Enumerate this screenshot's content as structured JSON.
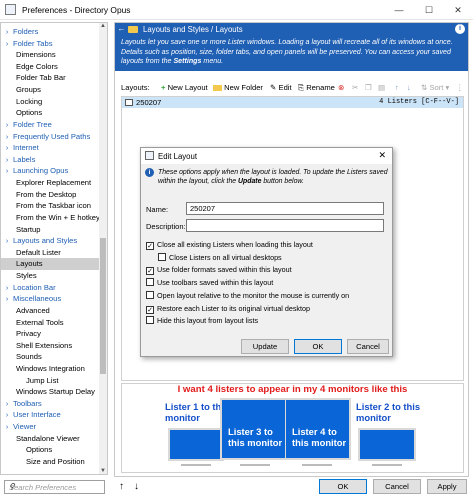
{
  "window": {
    "title": "Preferences - Directory Opus",
    "min": "—",
    "max": "☐",
    "close": "✕"
  },
  "sidebar": [
    {
      "label": "Folders",
      "type": "cat"
    },
    {
      "label": "Folder Tabs",
      "type": "cat"
    },
    {
      "label": "Dimensions",
      "type": "sub"
    },
    {
      "label": "Edge Colors",
      "type": "sub"
    },
    {
      "label": "Folder Tab Bar",
      "type": "sub"
    },
    {
      "label": "Groups",
      "type": "sub"
    },
    {
      "label": "Locking",
      "type": "sub"
    },
    {
      "label": "Options",
      "type": "sub"
    },
    {
      "label": "Folder Tree",
      "type": "cat"
    },
    {
      "label": "Frequently Used Paths",
      "type": "cat"
    },
    {
      "label": "Internet",
      "type": "cat"
    },
    {
      "label": "Labels",
      "type": "cat"
    },
    {
      "label": "Launching Opus",
      "type": "cat"
    },
    {
      "label": "Explorer Replacement",
      "type": "sub"
    },
    {
      "label": "From the Desktop",
      "type": "sub"
    },
    {
      "label": "From the Taskbar icon",
      "type": "sub"
    },
    {
      "label": "From the Win + E hotkey",
      "type": "sub"
    },
    {
      "label": "Startup",
      "type": "sub"
    },
    {
      "label": "Layouts and Styles",
      "type": "cat"
    },
    {
      "label": "Default Lister",
      "type": "sub"
    },
    {
      "label": "Layouts",
      "type": "sub",
      "selected": true
    },
    {
      "label": "Styles",
      "type": "sub"
    },
    {
      "label": "Location Bar",
      "type": "cat"
    },
    {
      "label": "Miscellaneous",
      "type": "cat"
    },
    {
      "label": "Advanced",
      "type": "sub"
    },
    {
      "label": "External Tools",
      "type": "sub"
    },
    {
      "label": "Privacy",
      "type": "sub"
    },
    {
      "label": "Shell Extensions",
      "type": "sub"
    },
    {
      "label": "Sounds",
      "type": "sub"
    },
    {
      "label": "Windows Integration",
      "type": "sub"
    },
    {
      "label": "Jump List",
      "type": "sub2"
    },
    {
      "label": "Windows Startup Delay",
      "type": "sub"
    },
    {
      "label": "Toolbars",
      "type": "cat"
    },
    {
      "label": "User Interface",
      "type": "cat"
    },
    {
      "label": "Viewer",
      "type": "cat"
    },
    {
      "label": "Standalone Viewer",
      "type": "sub"
    },
    {
      "label": "Options",
      "type": "sub2"
    },
    {
      "label": "Size and Position",
      "type": "sub2"
    }
  ],
  "search": {
    "placeholder": "Search Preferences"
  },
  "header": {
    "breadcrumb": "Layouts and Styles / Layouts"
  },
  "intro": {
    "text_a": "Layouts let you save one or more Lister windows. Loading a layout will recreate all of its windows at once. Details such as position, size, folder tabs, and open panels will be preserved. You can access your saved layouts from the ",
    "text_bold": "Settings",
    "text_b": " menu."
  },
  "toolbar": {
    "label": "Layouts:",
    "new_layout": "New Layout",
    "new_folder": "New Folder",
    "edit": "Edit",
    "rename": "Rename",
    "sort": "Sort"
  },
  "layouts": [
    {
      "name": "250207",
      "count": "4 Listers [C-F--V-]"
    }
  ],
  "preview": {
    "title": "I want 4 listers to appear in my 4 monitors like this",
    "labels": {
      "l1": "Lister 1 to this monitor",
      "l2": "Lister 2 to this monitor",
      "l3": "Lister 3 to this monitor",
      "l4": "Lister 4 to this monitor"
    }
  },
  "dialog": {
    "title": "Edit Layout",
    "close": "✕",
    "note_a": "These options apply when the layout is loaded. To update the Listers saved within the layout, click the ",
    "note_bold": "Update",
    "note_b": " button below.",
    "name_label": "Name:",
    "name_value": "250207",
    "desc_label": "Description:",
    "desc_value": "",
    "options": [
      {
        "label": "Close all existing Listers when loading this layout",
        "checked": true
      },
      {
        "label": "Close Listers on all virtual desktops",
        "checked": false
      },
      {
        "label": "Use folder formats saved within this layout",
        "checked": true
      },
      {
        "label": "Use toolbars saved within this layout",
        "checked": false
      },
      {
        "label": "Open layout relative to the monitor the mouse is currently on",
        "checked": false
      },
      {
        "label": "Restore each Lister to its original virtual desktop",
        "checked": true
      },
      {
        "label": "Hide this layout from layout lists",
        "checked": false
      }
    ],
    "buttons": {
      "update": "Update",
      "ok": "OK",
      "cancel": "Cancel"
    }
  },
  "footer": {
    "up": "↑",
    "down": "↓",
    "ok": "OK",
    "cancel": "Cancel",
    "apply": "Apply"
  }
}
